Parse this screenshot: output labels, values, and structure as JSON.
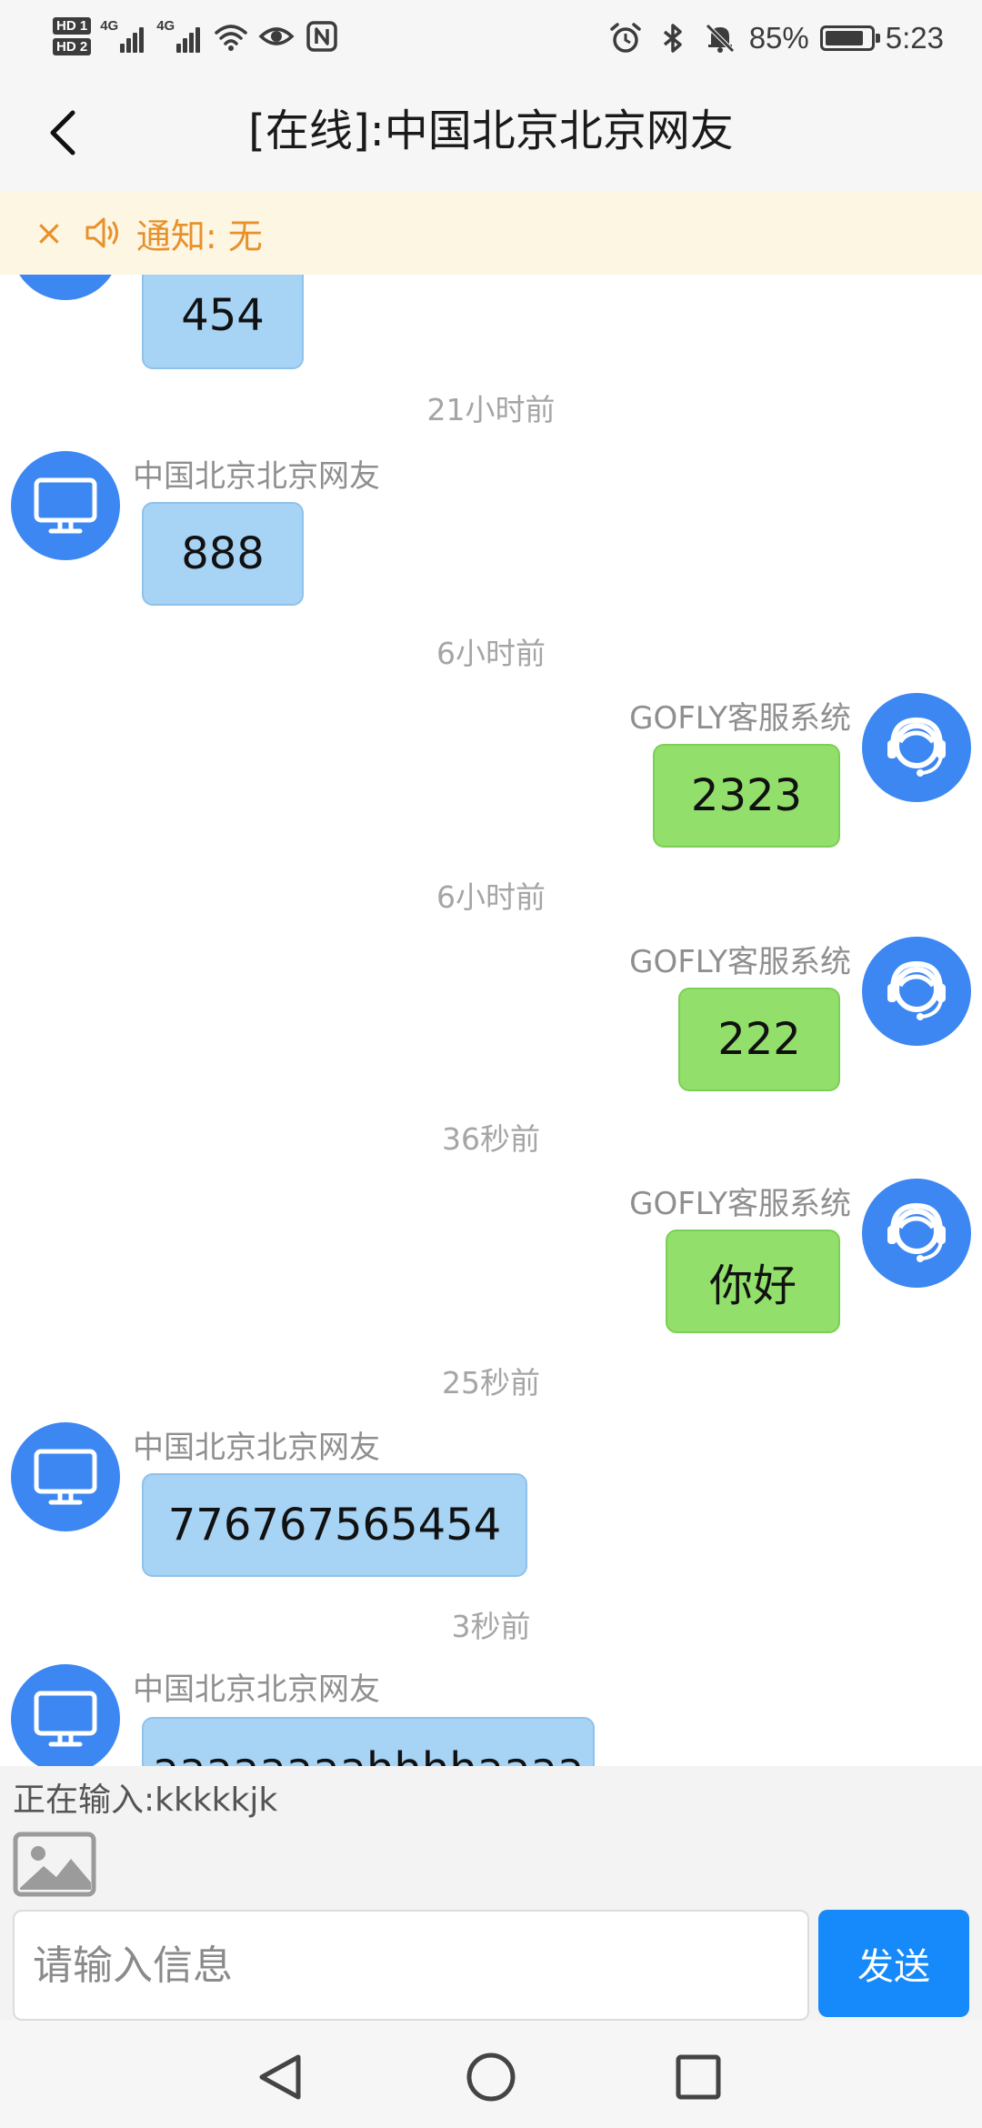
{
  "status_bar": {
    "hd1": "HD 1",
    "hd2": "HD 2",
    "net1": "4G",
    "net2": "4G",
    "battery_percent": "85%",
    "battery_level": 0.85,
    "time": "5:23",
    "icons": [
      "wifi-icon",
      "eye-icon",
      "nfc-icon",
      "alarm-icon",
      "bluetooth-icon",
      "bell-mute-icon",
      "battery-icon"
    ]
  },
  "header": {
    "title": "[在线]:中国北京北京网友",
    "back_icon": "chevron-left-icon"
  },
  "notice": {
    "close": "×",
    "text": "通知: 无",
    "speaker_icon": "speaker-icon"
  },
  "colors": {
    "visitor_bubble": "#a7d3f5",
    "agent_bubble": "#92df6b",
    "avatar": "#3d87f2",
    "send_button": "#1689fb",
    "notice_text": "#e8912b"
  },
  "messages": [
    {
      "sender": "中国北京北京网友",
      "role": "visitor",
      "text": "454",
      "time": ""
    },
    {
      "sender": "中国北京北京网友",
      "role": "visitor",
      "text": "888",
      "time": "21小时前"
    },
    {
      "sender": "GOFLY客服系统",
      "role": "agent",
      "text": "2323",
      "time": "6小时前"
    },
    {
      "sender": "GOFLY客服系统",
      "role": "agent",
      "text": "222",
      "time": "6小时前"
    },
    {
      "sender": "GOFLY客服系统",
      "role": "agent",
      "text": "你好",
      "time": "36秒前"
    },
    {
      "sender": "中国北京北京网友",
      "role": "visitor",
      "text": "776767565454",
      "time": "25秒前"
    },
    {
      "sender": "中国北京北京网友",
      "role": "visitor",
      "text": "aaaaaaaahhhhaaaa",
      "time": "3秒前"
    }
  ],
  "input": {
    "typing_status": "正在输入:kkkkkjk",
    "placeholder": "请输入信息",
    "value": "",
    "send_label": "发送",
    "image_icon": "image-icon"
  },
  "nav": {
    "icons": [
      "nav-back-icon",
      "nav-home-icon",
      "nav-recents-icon"
    ]
  }
}
